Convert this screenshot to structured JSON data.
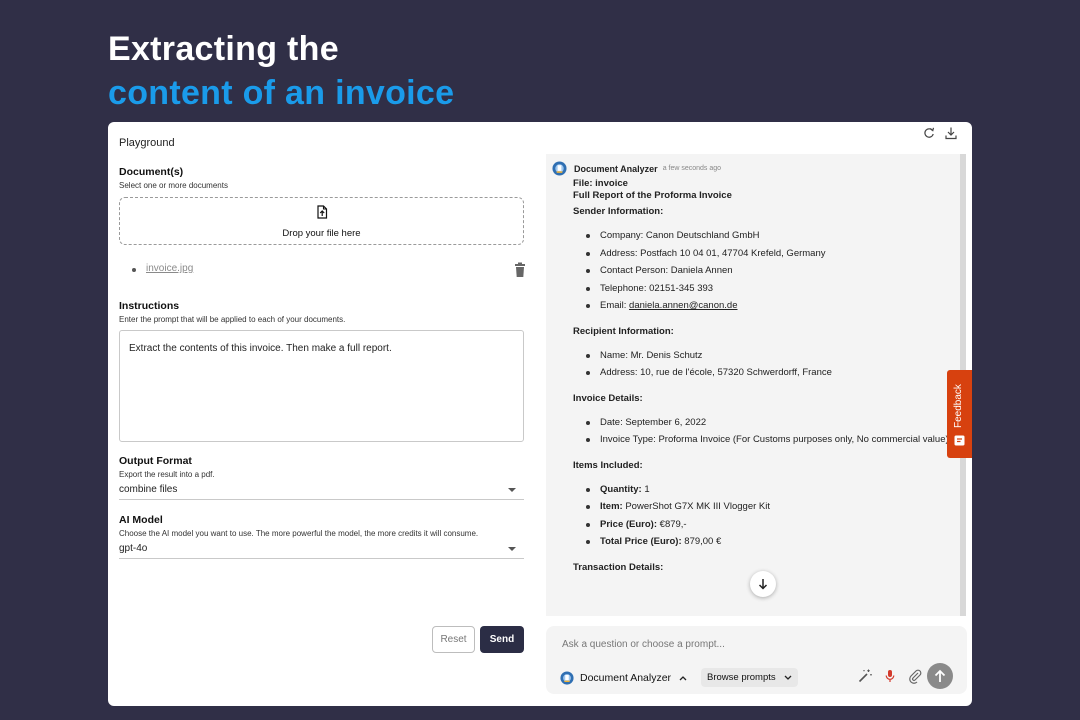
{
  "hero": {
    "line1": "Extracting the",
    "line2": "content of an invoice"
  },
  "playground": {
    "title": "Playground",
    "documents": {
      "title": "Document(s)",
      "subtitle": "Select one or more documents",
      "drop_label": "Drop your file here",
      "files": [
        "invoice.jpg"
      ]
    },
    "instructions": {
      "title": "Instructions",
      "subtitle": "Enter the prompt that will be applied to each of your documents.",
      "value": "Extract the contents of this invoice. Then make a full report."
    },
    "output_format": {
      "title": "Output Format",
      "subtitle": "Export the result into a pdf.",
      "value": "combine files"
    },
    "ai_model": {
      "title": "AI Model",
      "subtitle": "Choose the AI model you want to use. The more powerful the model, the more credits it will consume.",
      "value": "gpt-4o"
    },
    "reset_label": "Reset",
    "send_label": "Send"
  },
  "chat": {
    "agent_name": "Document Analyzer",
    "time": "a few seconds ago",
    "file_line": "File: invoice",
    "report_title": "Full Report of the Proforma Invoice",
    "sender": {
      "heading": "Sender Information:",
      "company": "Company: Canon Deutschland GmbH",
      "address": "Address: Postfach 10 04 01, 47704 Krefeld, Germany",
      "contact": "Contact Person: Daniela Annen",
      "telephone": "Telephone: 02151-345 393",
      "email_label": "Email: ",
      "email": "daniela.annen@canon.de"
    },
    "recipient": {
      "heading": "Recipient Information:",
      "name": "Name: Mr. Denis Schutz",
      "address": "Address: 10, rue de l'école, 57320 Schwerdorff, France"
    },
    "invoice": {
      "heading": "Invoice Details:",
      "date": "Date: September 6, 2022",
      "type": "Invoice Type: Proforma Invoice (For Customs purposes only, No commercial value)"
    },
    "items": {
      "heading": "Items Included:",
      "quantity_label": "Quantity:",
      "quantity": " 1",
      "item_label": "Item:",
      "item": " PowerShot G7X MK III Vlogger Kit",
      "price_label": "Price (Euro):",
      "price": " €879,-",
      "total_label": "Total Price (Euro):",
      "total": " 879,00 €"
    },
    "transaction_heading": "Transaction Details:"
  },
  "composer": {
    "placeholder": "Ask a question or choose a prompt...",
    "agent_name": "Document Analyzer",
    "browse_label": "Browse prompts"
  },
  "feedback_label": "Feedback",
  "colors": {
    "background": "#302f47",
    "accent": "#1a9bea",
    "send_button": "#2b2d45",
    "feedback": "#d7410f"
  }
}
